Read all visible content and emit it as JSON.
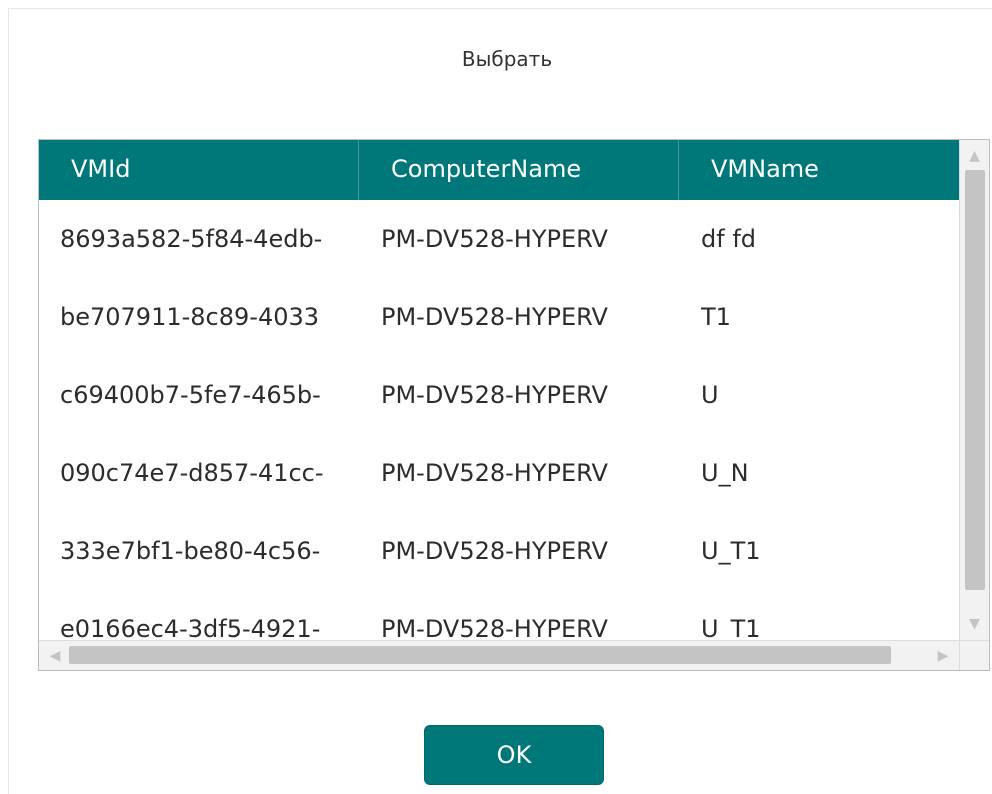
{
  "dialog": {
    "title": "Выбрать",
    "ok_label": "OK"
  },
  "table": {
    "columns": [
      "VMId",
      "ComputerName",
      "VMName"
    ],
    "rows": [
      {
        "vmid": "8693a582-5f84-4edb-",
        "computer": "PM-DV528-HYPERV",
        "vmname": "df fd"
      },
      {
        "vmid": "be707911-8c89-4033",
        "computer": "PM-DV528-HYPERV",
        "vmname": "T1"
      },
      {
        "vmid": "c69400b7-5fe7-465b-",
        "computer": "PM-DV528-HYPERV",
        "vmname": "U"
      },
      {
        "vmid": "090c74e7-d857-41cc-",
        "computer": "PM-DV528-HYPERV",
        "vmname": "U_N"
      },
      {
        "vmid": "333e7bf1-be80-4c56-",
        "computer": "PM-DV528-HYPERV",
        "vmname": "U_T1"
      },
      {
        "vmid": "e0166ec4-3df5-4921-",
        "computer": "PM-DV528-HYPERV",
        "vmname": "U_T1"
      }
    ]
  },
  "icons": {
    "scroll_up": "▲",
    "scroll_down": "▼",
    "scroll_left": "◀",
    "scroll_right": "▶"
  },
  "colors": {
    "accent": "#00787a"
  }
}
